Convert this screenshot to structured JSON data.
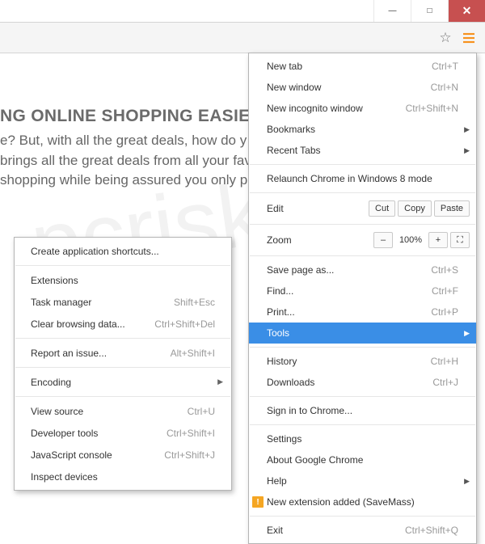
{
  "window": {
    "min": "—",
    "max": "□",
    "close": "✕"
  },
  "page": {
    "heading": "NG ONLINE SHOPPING EASIER AND",
    "line1": "e? But, with all the great deals, how do y",
    "line2": "brings all the great deals from all your fav",
    "line3": "shopping while being assured you only pick"
  },
  "menu": {
    "new_tab": {
      "label": "New tab",
      "sc": "Ctrl+T"
    },
    "new_window": {
      "label": "New window",
      "sc": "Ctrl+N"
    },
    "incognito": {
      "label": "New incognito window",
      "sc": "Ctrl+Shift+N"
    },
    "bookmarks": {
      "label": "Bookmarks"
    },
    "recent": {
      "label": "Recent Tabs"
    },
    "relaunch": {
      "label": "Relaunch Chrome in Windows 8 mode"
    },
    "edit": {
      "label": "Edit",
      "cut": "Cut",
      "copy": "Copy",
      "paste": "Paste"
    },
    "zoom": {
      "label": "Zoom",
      "minus": "–",
      "value": "100%",
      "plus": "+",
      "full": "⛶"
    },
    "save": {
      "label": "Save page as...",
      "sc": "Ctrl+S"
    },
    "find": {
      "label": "Find...",
      "sc": "Ctrl+F"
    },
    "print": {
      "label": "Print...",
      "sc": "Ctrl+P"
    },
    "tools": {
      "label": "Tools"
    },
    "history": {
      "label": "History",
      "sc": "Ctrl+H"
    },
    "downloads": {
      "label": "Downloads",
      "sc": "Ctrl+J"
    },
    "signin": {
      "label": "Sign in to Chrome..."
    },
    "settings": {
      "label": "Settings"
    },
    "about": {
      "label": "About Google Chrome"
    },
    "help": {
      "label": "Help"
    },
    "newext": {
      "label": "New extension added (SaveMass)"
    },
    "exit": {
      "label": "Exit",
      "sc": "Ctrl+Shift+Q"
    }
  },
  "submenu": {
    "shortcuts": {
      "label": "Create application shortcuts..."
    },
    "extensions": {
      "label": "Extensions"
    },
    "taskmgr": {
      "label": "Task manager",
      "sc": "Shift+Esc"
    },
    "clear": {
      "label": "Clear browsing data...",
      "sc": "Ctrl+Shift+Del"
    },
    "report": {
      "label": "Report an issue...",
      "sc": "Alt+Shift+I"
    },
    "encoding": {
      "label": "Encoding"
    },
    "viewsrc": {
      "label": "View source",
      "sc": "Ctrl+U"
    },
    "devtools": {
      "label": "Developer tools",
      "sc": "Ctrl+Shift+I"
    },
    "jsconsole": {
      "label": "JavaScript console",
      "sc": "Ctrl+Shift+J"
    },
    "inspect": {
      "label": "Inspect devices"
    }
  },
  "watermark": "pcrisk.com"
}
